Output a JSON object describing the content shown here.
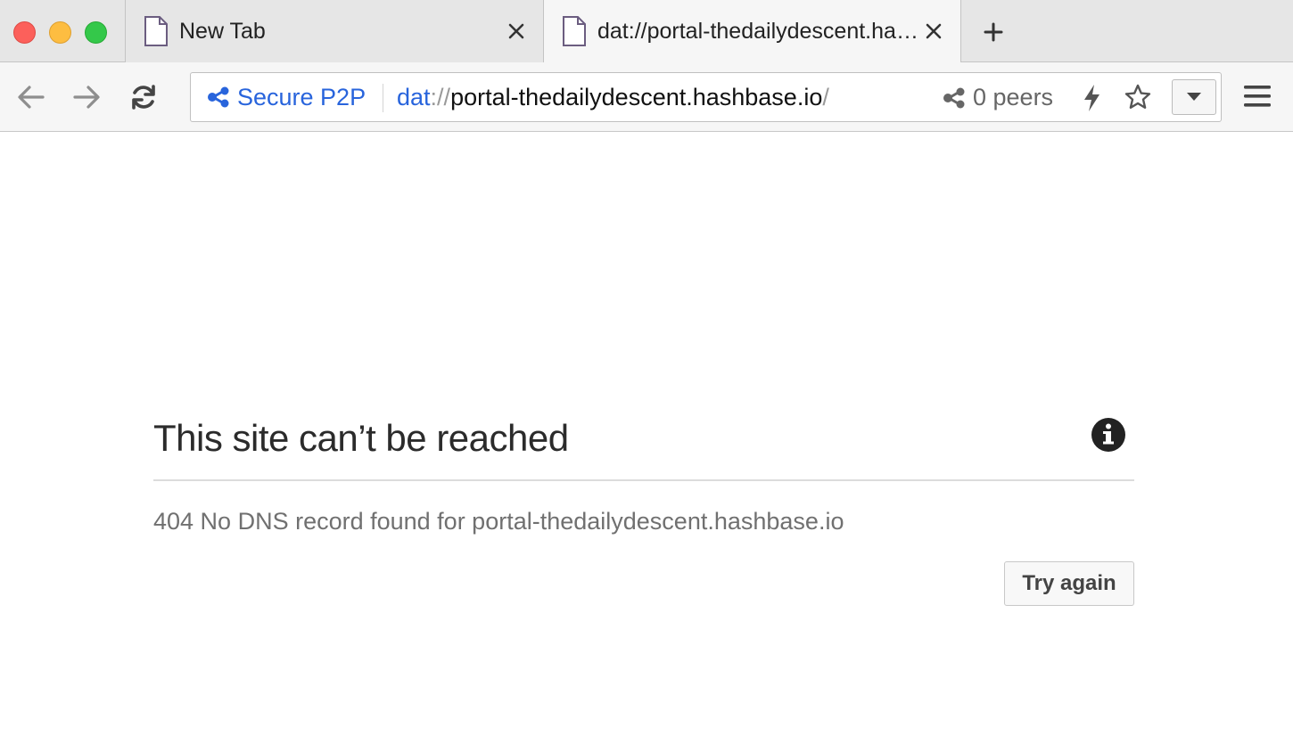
{
  "window": {
    "controls": [
      "close",
      "minimize",
      "maximize"
    ],
    "colors": {
      "close": "#fc605b",
      "minimize": "#fdbd41",
      "maximize": "#34c84a"
    }
  },
  "tabs": [
    {
      "title": "New Tab",
      "icon": "page-icon",
      "active": false
    },
    {
      "title": "dat://portal-thedailydescent.hashbase.io/",
      "icon": "page-icon",
      "active": true
    }
  ],
  "new_tab_icon": "plus-icon",
  "toolbar": {
    "icons": [
      "arrow-left-icon",
      "arrow-right-icon",
      "reload-icon",
      "hamburger-menu-icon"
    ]
  },
  "address_bar": {
    "secure_label": "Secure P2P",
    "secure_icon": "share-nodes-icon",
    "url_protocol": "dat",
    "url_separator": "://",
    "url_host": "portal-thedailydescent.hashbase.io",
    "url_trailing": "/",
    "peers_label": "0 peers",
    "peers_icon": "share-nodes-icon",
    "action_icons": [
      "lightning-bolt-icon",
      "star-icon",
      "caret-down-icon"
    ],
    "accent_color": "#2864dc"
  },
  "error_page": {
    "title": "This site can’t be reached",
    "info_icon": "info-circle-icon",
    "message": "404 No DNS record found for portal-thedailydescent.hashbase.io",
    "try_again_label": "Try again"
  }
}
